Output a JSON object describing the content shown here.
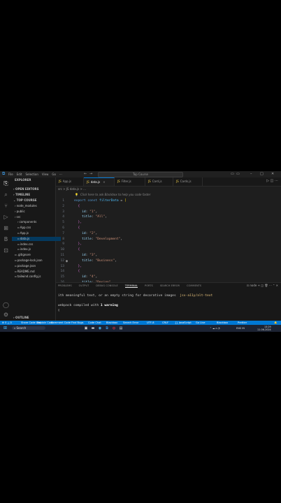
{
  "titlebar": {
    "menu": [
      "File",
      "Edit",
      "Selection",
      "View",
      "Go",
      "···"
    ],
    "search": "Top Course"
  },
  "sidebar": {
    "title": "EXPLORER",
    "open_editors": "OPEN EDITORS",
    "timeline": "TIMELINE",
    "project": "TOP COURSE",
    "tree": [
      {
        "label": "node_modules",
        "indent": 1,
        "selected": false
      },
      {
        "label": "public",
        "indent": 1,
        "selected": false
      },
      {
        "label": "src",
        "indent": 1,
        "selected": false
      },
      {
        "label": "components",
        "indent": 2,
        "selected": false
      },
      {
        "label": "App.css",
        "indent": 2,
        "selected": false
      },
      {
        "label": "App.js",
        "indent": 2,
        "selected": false
      },
      {
        "label": "data.js",
        "indent": 2,
        "selected": true
      },
      {
        "label": "index.css",
        "indent": 2,
        "selected": false
      },
      {
        "label": "index.js",
        "indent": 2,
        "selected": false
      },
      {
        "label": ".gitignore",
        "indent": 1,
        "selected": false
      },
      {
        "label": "package-lock.json",
        "indent": 1,
        "selected": false
      },
      {
        "label": "package.json",
        "indent": 1,
        "selected": false
      },
      {
        "label": "README.md",
        "indent": 1,
        "selected": false
      },
      {
        "label": "tailwind.config.js",
        "indent": 1,
        "selected": false
      }
    ],
    "outline": "OUTLINE"
  },
  "tabs": [
    {
      "label": "App.js",
      "active": false
    },
    {
      "label": "data.js",
      "active": true
    },
    {
      "label": "Filter.js",
      "active": false
    },
    {
      "label": "Card.js",
      "active": false
    },
    {
      "label": "Cards.js",
      "active": false
    }
  ],
  "breadcrumb": "src > JS data.js > ...",
  "editor": {
    "hint": "Click here to ask Blackbox to help you code faster",
    "lines": [
      {
        "n": "1",
        "tokens": [
          {
            "t": "export const ",
            "c": "kw"
          },
          {
            "t": "filterData",
            "c": "var"
          },
          {
            "t": " = ",
            "c": ""
          },
          {
            "t": "[",
            "c": "punc"
          }
        ]
      },
      {
        "n": "2",
        "tokens": [
          {
            "t": "  {",
            "c": "brace"
          }
        ]
      },
      {
        "n": "3",
        "tokens": [
          {
            "t": "    id",
            "c": "prop"
          },
          {
            "t": ": ",
            "c": ""
          },
          {
            "t": "\"1\"",
            "c": "str"
          },
          {
            "t": ",",
            "c": ""
          }
        ]
      },
      {
        "n": "4",
        "tokens": [
          {
            "t": "    title",
            "c": "prop"
          },
          {
            "t": ": ",
            "c": ""
          },
          {
            "t": "\"All\"",
            "c": "str"
          },
          {
            "t": ",",
            "c": ""
          }
        ]
      },
      {
        "n": "5",
        "tokens": [
          {
            "t": "  },",
            "c": "brace"
          }
        ]
      },
      {
        "n": "6",
        "tokens": [
          {
            "t": "  {",
            "c": "brace"
          }
        ]
      },
      {
        "n": "7",
        "tokens": [
          {
            "t": "    id",
            "c": "prop"
          },
          {
            "t": ": ",
            "c": ""
          },
          {
            "t": "\"2\"",
            "c": "str"
          },
          {
            "t": ",",
            "c": ""
          }
        ]
      },
      {
        "n": "8",
        "tokens": [
          {
            "t": "    title",
            "c": "prop"
          },
          {
            "t": ": ",
            "c": ""
          },
          {
            "t": "\"Development\"",
            "c": "str"
          },
          {
            "t": ",",
            "c": ""
          }
        ]
      },
      {
        "n": "9",
        "tokens": [
          {
            "t": "  },",
            "c": "brace"
          }
        ]
      },
      {
        "n": "10",
        "tokens": [
          {
            "t": "  {",
            "c": "brace"
          }
        ]
      },
      {
        "n": "11",
        "tokens": [
          {
            "t": "    id",
            "c": "prop"
          },
          {
            "t": ": ",
            "c": ""
          },
          {
            "t": "\"3\"",
            "c": "str"
          },
          {
            "t": ",",
            "c": ""
          }
        ]
      },
      {
        "n": "12",
        "tokens": [
          {
            "t": "    title",
            "c": "prop"
          },
          {
            "t": ": ",
            "c": ""
          },
          {
            "t": "\"Business\"",
            "c": "str"
          },
          {
            "t": ",",
            "c": ""
          }
        ]
      },
      {
        "n": "13",
        "tokens": [
          {
            "t": "  },",
            "c": "brace"
          }
        ]
      },
      {
        "n": "14",
        "tokens": [
          {
            "t": "  {",
            "c": "brace"
          }
        ]
      },
      {
        "n": "15",
        "tokens": [
          {
            "t": "    id",
            "c": "prop"
          },
          {
            "t": ": ",
            "c": ""
          },
          {
            "t": "\"4\"",
            "c": "str"
          },
          {
            "t": ",",
            "c": ""
          }
        ]
      },
      {
        "n": "16",
        "tokens": [
          {
            "t": "    title",
            "c": "prop"
          },
          {
            "t": ": ",
            "c": ""
          },
          {
            "t": "\"Design\"",
            "c": "str"
          }
        ]
      }
    ]
  },
  "panel": {
    "tabs": [
      {
        "label": "PROBLEMS",
        "active": false
      },
      {
        "label": "OUTPUT",
        "active": false
      },
      {
        "label": "DEBUG CONSOLE",
        "active": false
      },
      {
        "label": "TERMINAL",
        "active": true
      },
      {
        "label": "PORTS",
        "active": false
      },
      {
        "label": "SEARCH ERROR",
        "active": false
      },
      {
        "label": "COMMENTS",
        "active": false
      }
    ],
    "shell": "node",
    "terminal_line1_prefix": "ith meaningful text, or an empty string for decorative images",
    "terminal_line1_rule": "jsx-a11y/alt-text",
    "terminal_line2_prefix": "webpack compiled with ",
    "terminal_line2_bold": "1 warning",
    "cursor": "▯"
  },
  "statusbar": {
    "items": [
      "⊗ 0 △ 0",
      "Share Code Link",
      "Explain Code",
      "Comment Code",
      "Find Bugs",
      "Code Chat",
      "Blackbox",
      "Search Error",
      "UTF-8",
      "CRLF",
      "{} JavaScript",
      "Go Live",
      "Blackbox",
      "Prettier"
    ],
    "position": "Ln 2, Col 3  Spaces: 2"
  },
  "taskbar": {
    "search": "Search",
    "tray_time": "13:29",
    "tray_date": "11-06-2024",
    "tray_lang": "ENG IN"
  },
  "colors": {
    "accent": "#0078d4",
    "editor_bg": "#1e1e1e",
    "sidebar_bg": "#181818"
  }
}
